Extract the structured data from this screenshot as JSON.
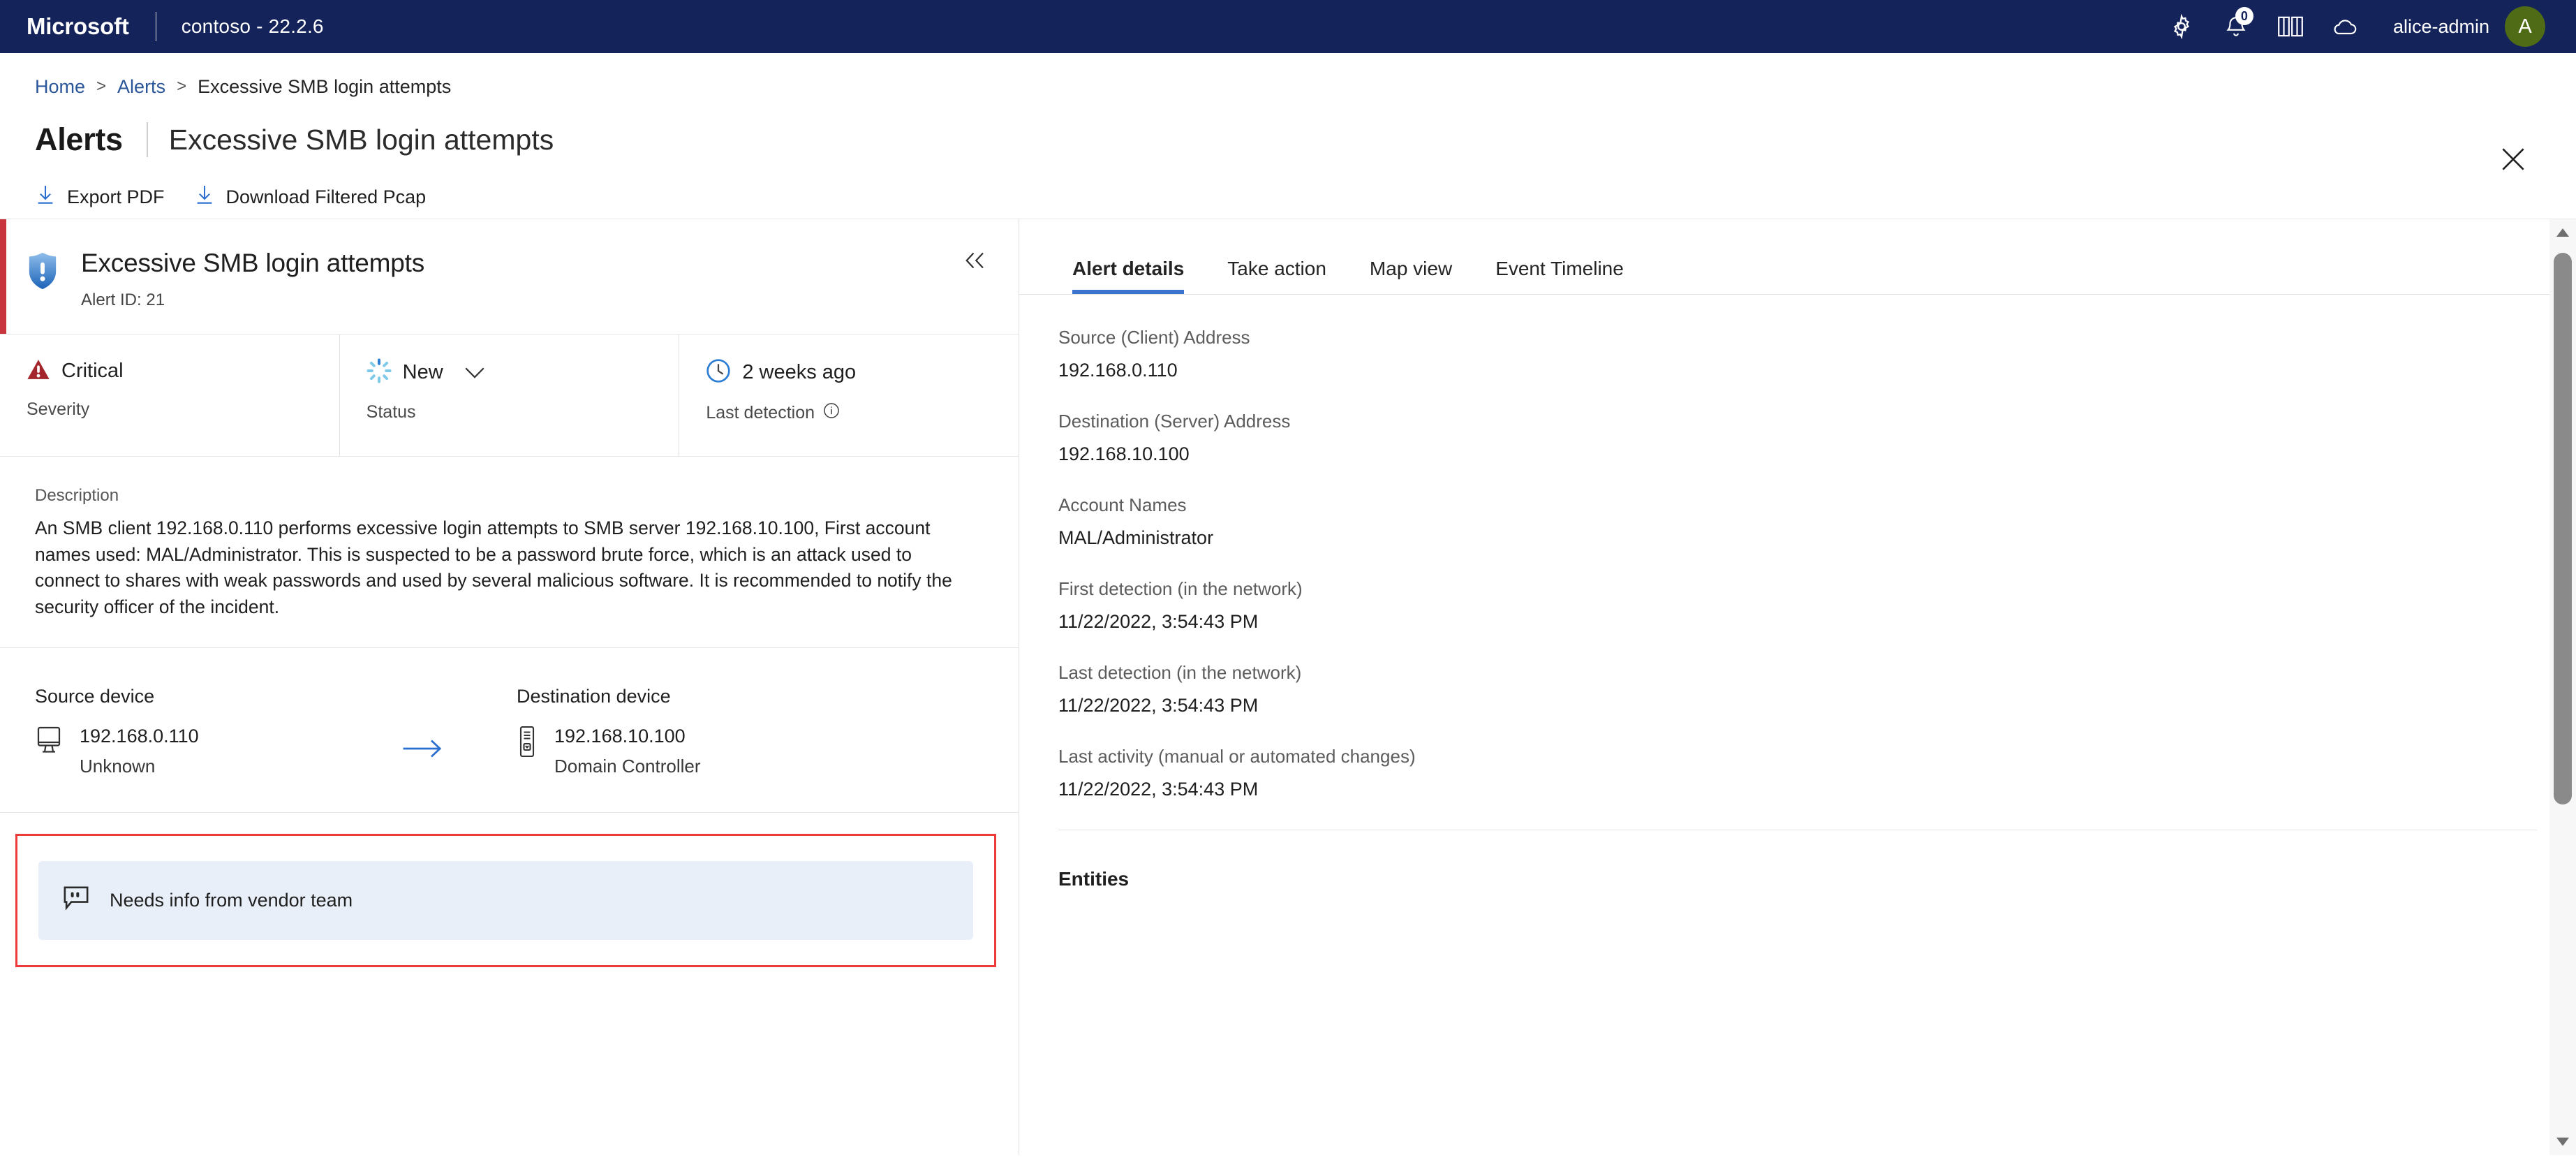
{
  "topbar": {
    "brand": "Microsoft",
    "tenant": "contoso - 22.2.6",
    "icons": [
      "gear-icon",
      "bell-icon",
      "book-icon",
      "cloud-icon"
    ],
    "notification_count": "0",
    "username": "alice-admin",
    "avatar_initial": "A",
    "avatar_color": "#4F6B16",
    "background_color": "#15235B"
  },
  "breadcrumb": {
    "home": "Home",
    "alerts": "Alerts",
    "current": "Excessive SMB login attempts",
    "separator": ">"
  },
  "page_title": {
    "main": "Alerts",
    "sub": "Excessive SMB login attempts"
  },
  "commandbar": {
    "export_pdf": "Export PDF",
    "download_pcap": "Download Filtered Pcap"
  },
  "alert": {
    "title": "Excessive SMB login attempts",
    "alert_id": "Alert ID: 21",
    "severity_accent": "#C8353C",
    "meta": {
      "severity_value": "Critical",
      "severity_label": "Severity",
      "severity_color": "#A4262C",
      "status_value": "New",
      "status_label": "Status",
      "status_color": "#7FC9E8",
      "detection_value": "2 weeks ago",
      "detection_label": "Last detection",
      "detection_color": "#2B7CD3"
    },
    "description_label": "Description",
    "description": "An SMB client 192.168.0.110 performs excessive login attempts to SMB server 192.168.10.100, First account names used: MAL/Administrator. This is suspected to be a password brute force, which is an attack used to connect to shares with weak passwords and used by several malicious software. It is recommended to notify the security officer of the incident.",
    "source_device": {
      "heading": "Source device",
      "ip": "192.168.0.110",
      "type": "Unknown"
    },
    "destination_device": {
      "heading": "Destination device",
      "ip": "192.168.10.100",
      "type": "Domain Controller"
    },
    "comment": {
      "text": "Needs info from vendor team",
      "highlight_color": "#ED3B3B",
      "background_color": "#E8EFF9"
    }
  },
  "right_panel": {
    "tabs": [
      {
        "label": "Alert details",
        "active": true
      },
      {
        "label": "Take action",
        "active": false
      },
      {
        "label": "Map view",
        "active": false
      },
      {
        "label": "Event Timeline",
        "active": false
      }
    ],
    "active_tab_color": "#3A74CF",
    "details": [
      {
        "label": "Source (Client) Address",
        "value": "192.168.0.110"
      },
      {
        "label": "Destination (Server) Address",
        "value": "192.168.10.100"
      },
      {
        "label": "Account Names",
        "value": "MAL/Administrator"
      },
      {
        "label": "First detection (in the network)",
        "value": "11/22/2022, 3:54:43 PM"
      },
      {
        "label": "Last detection (in the network)",
        "value": "11/22/2022, 3:54:43 PM"
      },
      {
        "label": "Last activity (manual or automated changes)",
        "value": "11/22/2022, 3:54:43 PM"
      }
    ],
    "entities_heading": "Entities"
  }
}
